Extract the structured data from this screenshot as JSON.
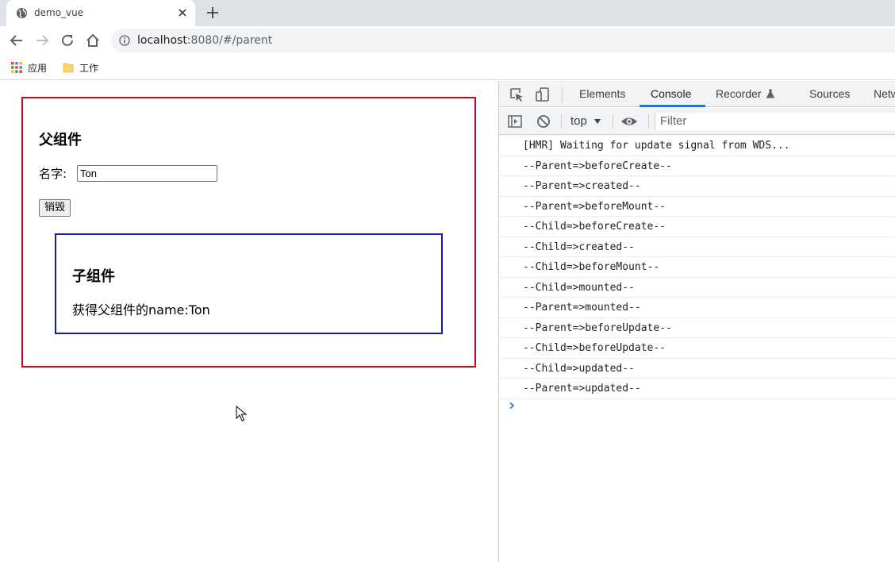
{
  "browser": {
    "tab_title": "demo_vue",
    "url_host": "localhost",
    "url_path": ":8080/#/parent",
    "bookmarks": [
      {
        "label": "应用",
        "icon": "apps-grid-icon"
      },
      {
        "label": "工作",
        "icon": "folder-icon"
      }
    ]
  },
  "page": {
    "parent": {
      "title": "父组件",
      "name_label": "名字:",
      "name_value": "Ton",
      "destroy_label": "销毁"
    },
    "child": {
      "title": "子组件",
      "text": "获得父组件的name:Ton"
    }
  },
  "devtools": {
    "tabs": [
      {
        "label": "Elements",
        "active": false
      },
      {
        "label": "Console",
        "active": true
      },
      {
        "label": "Recorder",
        "active": false
      },
      {
        "label": "Sources",
        "active": false
      },
      {
        "label": "Netw",
        "active": false
      }
    ],
    "context": "top",
    "filter_placeholder": "Filter",
    "logs": [
      "[HMR] Waiting for update signal from WDS...",
      "--Parent=>beforeCreate--",
      "--Parent=>created--",
      "--Parent=>beforeMount--",
      "--Child=>beforeCreate--",
      "--Child=>created--",
      "--Child=>beforeMount--",
      "--Child=>mounted--",
      "--Parent=>mounted--",
      "--Parent=>beforeUpdate--",
      "--Child=>beforeUpdate--",
      "--Child=>updated--",
      "--Parent=>updated--"
    ],
    "accent_color": "#1a73e8"
  },
  "colors": {
    "parent_border": "#d9001b",
    "child_border": "#1a1aa6"
  }
}
